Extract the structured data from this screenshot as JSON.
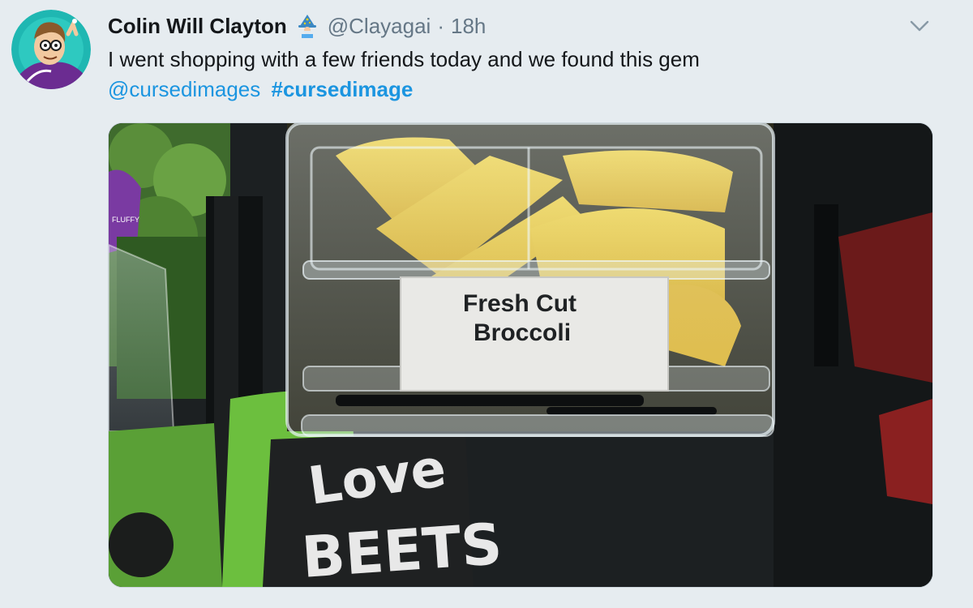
{
  "tweet": {
    "author": {
      "display_name": "Colin Will Clayton",
      "handle": "@Clayagai",
      "emoji": "mage-emoji",
      "avatar": "cartoon-avatar"
    },
    "separator": "·",
    "time": "18h",
    "text": {
      "line1": "I went shopping with a few friends today and we found this gem",
      "mention": "@cursedimages",
      "hashtag": "#cursedimage"
    },
    "media": {
      "type": "photo",
      "label_line1": "Fresh Cut",
      "label_line2": "Broccoli",
      "package_line1": "Love",
      "package_line2": "BEETS",
      "sticker_text": "FLUFFY"
    },
    "menu_icon": "chevron-down-icon"
  },
  "colors": {
    "background": "#e6ecf0",
    "link": "#1b95e0",
    "text": "#14171a",
    "secondary": "#657786"
  }
}
